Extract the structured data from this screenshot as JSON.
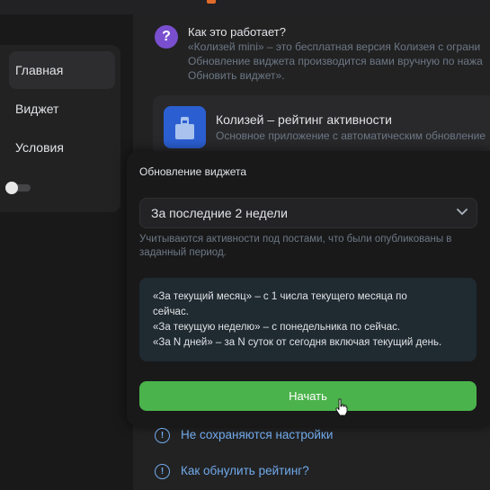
{
  "sidebar": {
    "items": [
      {
        "label": "Главная",
        "active": true
      },
      {
        "label": "Виджет",
        "active": false
      },
      {
        "label": "Условия",
        "active": false
      }
    ],
    "toggle_on": false
  },
  "how": {
    "title": "Как это работает?",
    "lines": [
      "«Колизей mini» – это бесплатная версия Колизея с ограни",
      "Обновление виджета производится вами вручную по нажа",
      "Обновить виджет»."
    ]
  },
  "app": {
    "title": "Колизей – рейтинг активности",
    "subtitle": "Основное приложение с автоматическим обновление"
  },
  "modal": {
    "title": "Обновление виджета",
    "period_selected": "За последние 2 недели",
    "hint": "Учитываются активности под постами, что были опубликованы в заданный период.",
    "info_lines": [
      "«За текущий месяц» – с 1 числа текущего месяца по",
      "сейчас.",
      "«За текущую неделю» – с понедельника по сейчас.",
      "«За N дней» – за N суток от сегодня включая текущий день."
    ],
    "start_label": "Начать"
  },
  "faq": [
    "Не сохраняются настройки",
    "Как обнулить рейтинг?"
  ],
  "colors": {
    "accent_green": "#4bb34b",
    "link_blue": "#71aaeb",
    "app_icon_blue": "#2b5fd1",
    "question_purple": "#7a4fcf"
  }
}
